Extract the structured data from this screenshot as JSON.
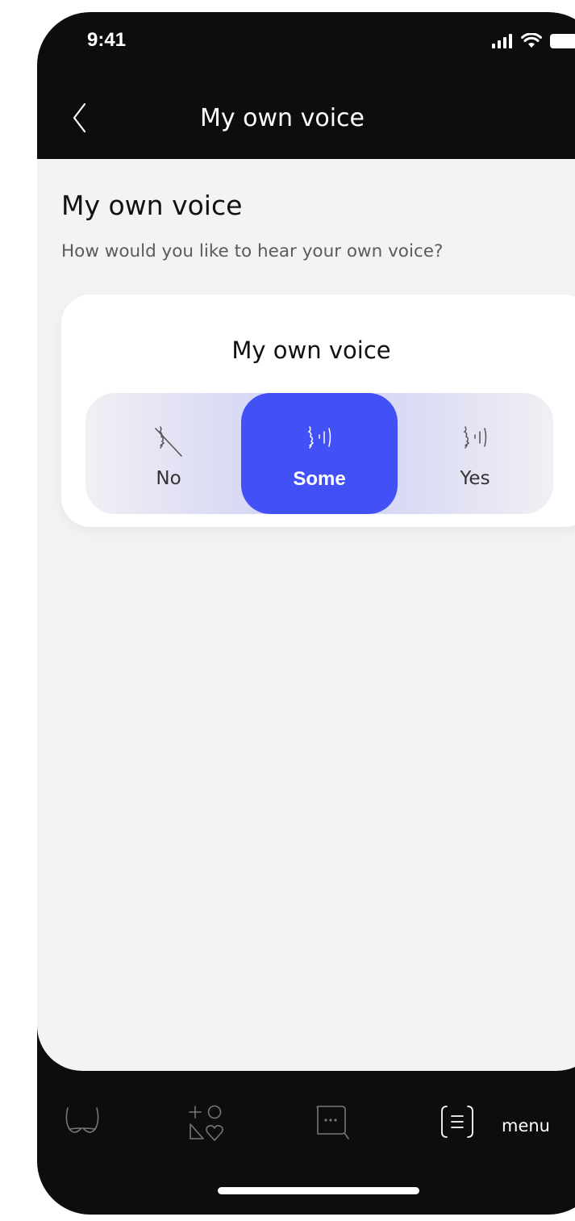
{
  "status_bar": {
    "time": "9:41"
  },
  "nav": {
    "title": "My own voice"
  },
  "page": {
    "title": "My own voice",
    "subtitle": "How would you like to hear your own voice?"
  },
  "card": {
    "title": "My own voice",
    "options": [
      {
        "label": "No",
        "icon": "voice-off-icon"
      },
      {
        "label": "Some",
        "icon": "voice-some-icon",
        "selected": true
      },
      {
        "label": "Yes",
        "icon": "voice-on-icon"
      }
    ]
  },
  "tab_bar": {
    "items": [
      {
        "icon": "hearing-aids-icon"
      },
      {
        "icon": "shapes-favorites-icon"
      },
      {
        "icon": "chat-icon"
      },
      {
        "icon": "menu-icon",
        "label": "menu"
      }
    ]
  },
  "colors": {
    "accent": "#4251F5",
    "background": "#0D0D0D",
    "content_bg": "#F3F3F3"
  }
}
